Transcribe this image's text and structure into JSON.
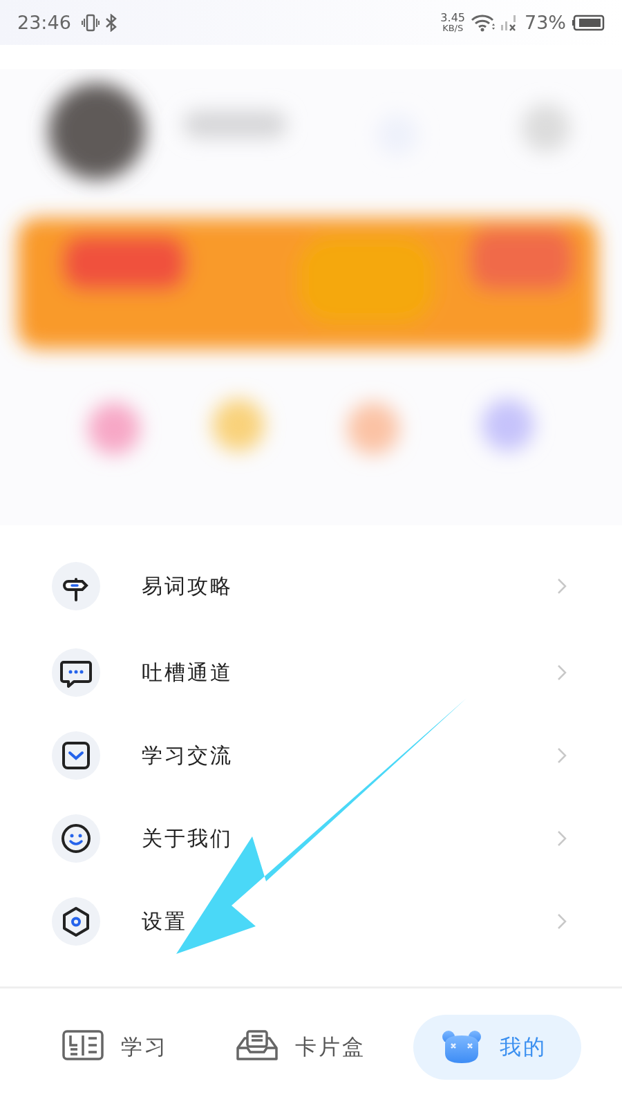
{
  "status_bar": {
    "time": "23:46",
    "net_speed": "3.45",
    "net_unit": "KB/S",
    "battery": "73%"
  },
  "menu": [
    {
      "kind": "guide",
      "label": "易词攻略"
    },
    {
      "kind": "feedback",
      "label": "吐槽通道"
    },
    {
      "kind": "chat",
      "label": "学习交流"
    },
    {
      "kind": "about",
      "label": "关于我们"
    },
    {
      "kind": "settings",
      "label": "设置"
    }
  ],
  "tabs": [
    {
      "kind": "study",
      "label": "学习",
      "selected": false
    },
    {
      "kind": "cards",
      "label": "卡片盒",
      "selected": false
    },
    {
      "kind": "me",
      "label": "我的",
      "selected": true
    }
  ]
}
